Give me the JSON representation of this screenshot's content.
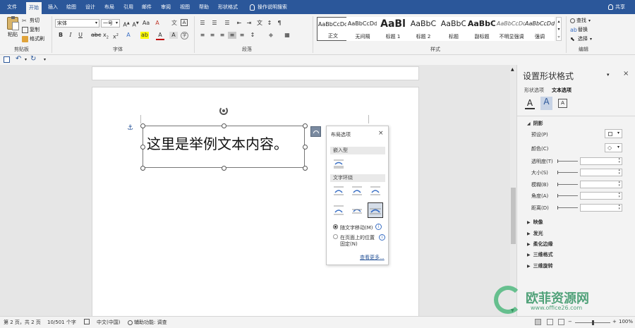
{
  "tabs": [
    "文件",
    "开始",
    "插入",
    "绘图",
    "设计",
    "布局",
    "引用",
    "邮件",
    "审阅",
    "视图",
    "帮助",
    "形状格式"
  ],
  "active_tab": "开始",
  "tell_me": "操作说明搜索",
  "share": "共享",
  "clipboard": {
    "paste": "粘贴",
    "cut": "剪切",
    "copy": "复制",
    "format_painter": "格式刷",
    "label": "剪贴板"
  },
  "font": {
    "name": "宋体",
    "size": "一号",
    "label": "字体"
  },
  "paragraph": {
    "label": "段落"
  },
  "styles": {
    "items": [
      {
        "sample": "AaBbCcDd",
        "name": "正文"
      },
      {
        "sample": "AaBbCcDd",
        "name": "无间隔"
      },
      {
        "sample": "AaBl",
        "name": "标题 1"
      },
      {
        "sample": "AaBbC",
        "name": "标题 2"
      },
      {
        "sample": "AaBbC",
        "name": "标题"
      },
      {
        "sample": "AaBbC",
        "name": "副标题"
      },
      {
        "sample": "AaBbCcDd",
        "name": "不明显强调"
      },
      {
        "sample": "AaBbCcDd",
        "name": "强调"
      }
    ],
    "label": "样式"
  },
  "editing": {
    "find": "查找",
    "replace": "替换",
    "select": "选择",
    "label": "编辑"
  },
  "document": {
    "textbox_text": "这里是举例文本内容。"
  },
  "layout_popup": {
    "title": "布局选项",
    "inline_header": "嵌入型",
    "wrap_header": "文字环绕",
    "option_move": "随文字移动(M)",
    "option_fixed_line1": "在页面上的位置",
    "option_fixed_line2": "固定(N)",
    "see_more": "查看更多..."
  },
  "pane": {
    "title": "设置形状格式",
    "tab_shape": "形状选项",
    "tab_text": "文本选项",
    "shadow_section": "阴影",
    "preset": "预设(P)",
    "color": "颜色(C)",
    "transparency": "透明度(T)",
    "size": "大小(S)",
    "blur": "模糊(B)",
    "angle": "角度(A)",
    "distance": "距离(D)",
    "sections": [
      "映像",
      "发光",
      "柔化边缘",
      "三维格式",
      "三维旋转"
    ]
  },
  "status": {
    "page": "第 2 页，共 2 页",
    "words": "10/501 个字",
    "language": "中文(中国)",
    "accessibility": "辅助功能: 调查",
    "zoom": "100%"
  },
  "watermark": {
    "text": "欧菲资源网",
    "url": "www.office26.com"
  },
  "colors": {
    "ribbon_blue": "#2b579a",
    "accent_green": "#3cb371"
  }
}
